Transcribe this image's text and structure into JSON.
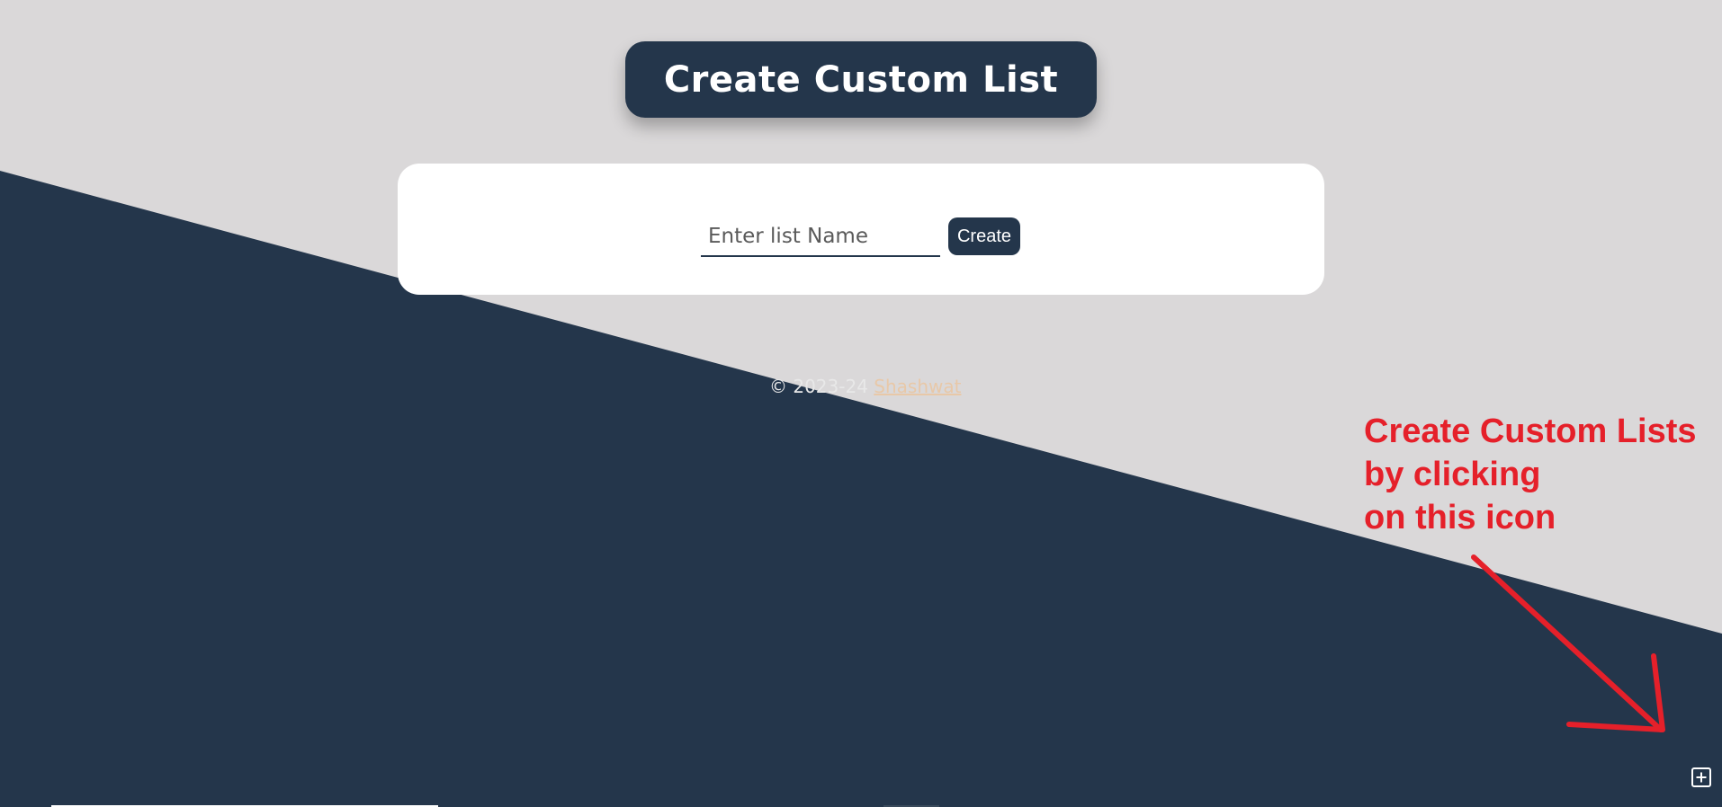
{
  "header": {
    "title": "Create Custom List"
  },
  "form": {
    "input_placeholder": "Enter list Name",
    "input_value": "",
    "create_label": "Create"
  },
  "footer": {
    "copyright_prefix": "© 2023-24",
    "author": "Shashwat"
  },
  "annotation": {
    "lines": [
      "Create Custom Lists",
      "by clicking",
      "on this icon"
    ]
  },
  "icons": {
    "add": "plus-square-icon",
    "arrow": "arrow-icon"
  },
  "colors": {
    "background": "#dad8d9",
    "navy": "#24364b",
    "annotation_red": "#e5202a",
    "card": "#ffffff"
  }
}
